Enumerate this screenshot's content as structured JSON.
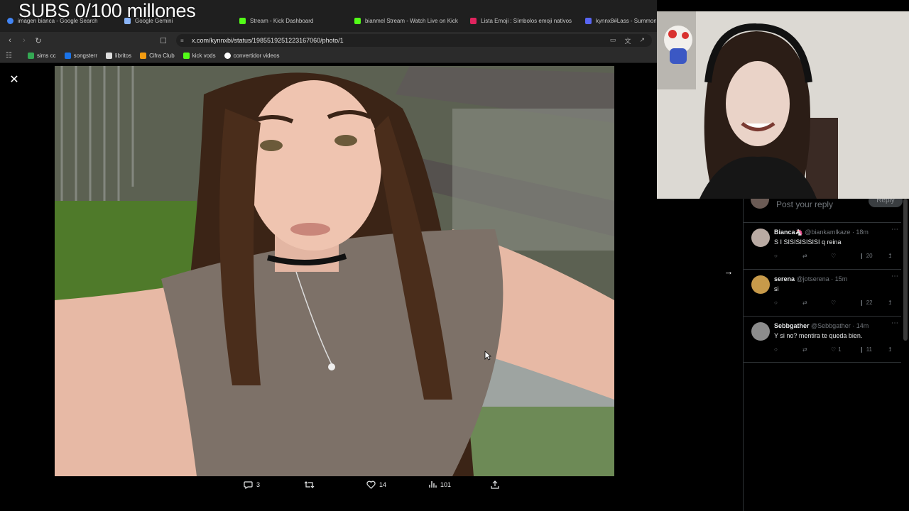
{
  "overlay": {
    "subs_text": "SUBS 0/100 millones"
  },
  "browser": {
    "tabs": [
      {
        "label": "imagen bianca - Google Search",
        "color": "#4285f4"
      },
      {
        "label": "Google Gemini",
        "color": "#8ab4f8"
      },
      {
        "label": "Stream - Kick Dashboard",
        "color": "#53fc18"
      },
      {
        "label": "bianmel Stream - Watch Live on Kick",
        "color": "#53fc18"
      },
      {
        "label": "Lista Emoji : Símbolos emoji nativos",
        "color": "#e0245e"
      },
      {
        "label": "kynnx8#Lass - Summon",
        "color": "#5865f2"
      }
    ],
    "url": "x.com/kynnxbi/status/1985519251223167060/photo/1",
    "bookmarks": [
      {
        "label": "sims cc",
        "color": "#34a853"
      },
      {
        "label": "songsterr",
        "color": "#1a73e8"
      },
      {
        "label": "libritos",
        "color": "#dddddd"
      },
      {
        "label": "Cifra Club",
        "color": "#f29b11"
      },
      {
        "label": "kick vods",
        "color": "#53fc18"
      },
      {
        "label": "convertidor videos",
        "color": "#ffffff"
      }
    ]
  },
  "viewer": {
    "close_icon": "x-icon",
    "next_icon": "arrow-right-icon",
    "actions": {
      "replies": "3",
      "retweets": "",
      "likes": "14",
      "views": "101"
    }
  },
  "panel": {
    "post_placeholder": "Post your reply",
    "reply_button": "Reply",
    "replies": [
      {
        "name": "Bianca🦄",
        "handle": "@biankamlkaze · 18m",
        "text": "S I SISISISISISI q reina",
        "reply_count": "",
        "retweet_count": "",
        "like_count": "",
        "views": "20",
        "avatar_color": "#b9aaa3"
      },
      {
        "name": "serena",
        "handle": "@jotserena · 15m",
        "text": "si",
        "reply_count": "",
        "retweet_count": "",
        "like_count": "",
        "views": "22",
        "avatar_color": "#c79a4a"
      },
      {
        "name": "Sebbgather",
        "handle": "@Sebbgather · 14m",
        "text": "Y si no? mentira te queda bien.",
        "reply_count": "",
        "retweet_count": "",
        "like_count": "1",
        "views": "11",
        "avatar_color": "#8c8c8c"
      }
    ]
  },
  "colors": {
    "background": "#000000",
    "text": "#e7e9ea",
    "muted": "#71767b",
    "border": "#2f3336"
  }
}
